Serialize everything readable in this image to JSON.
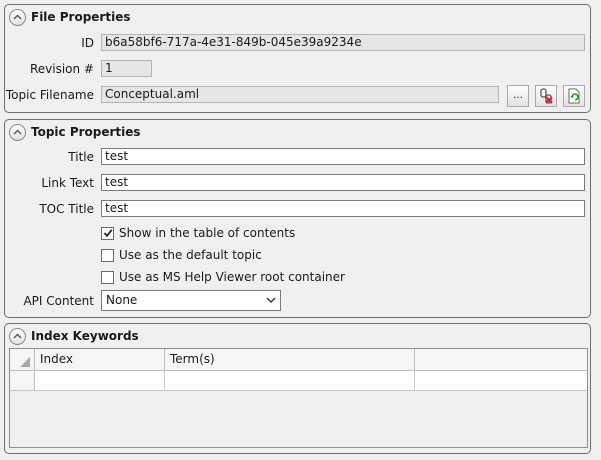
{
  "file_properties": {
    "title": "File Properties",
    "id_label": "ID",
    "id_value": "b6a58bf6-717a-4e31-849b-045e39a9234e",
    "revision_label": "Revision #",
    "revision_value": "1",
    "topic_filename_label": "Topic Filename",
    "topic_filename_value": "Conceptual.aml",
    "browse_label": "..."
  },
  "topic_properties": {
    "title": "Topic Properties",
    "title_label": "Title",
    "title_value": "test",
    "link_text_label": "Link Text",
    "link_text_value": "test",
    "toc_title_label": "TOC Title",
    "toc_title_value": "test",
    "checkboxes": [
      {
        "label": "Show in the table of contents",
        "checked": true
      },
      {
        "label": "Use as the default topic",
        "checked": false
      },
      {
        "label": "Use as MS Help Viewer root container",
        "checked": false
      }
    ],
    "api_content_label": "API Content",
    "api_content_value": "None"
  },
  "index_keywords": {
    "title": "Index Keywords",
    "columns": [
      "Index",
      "Term(s)",
      ""
    ]
  }
}
